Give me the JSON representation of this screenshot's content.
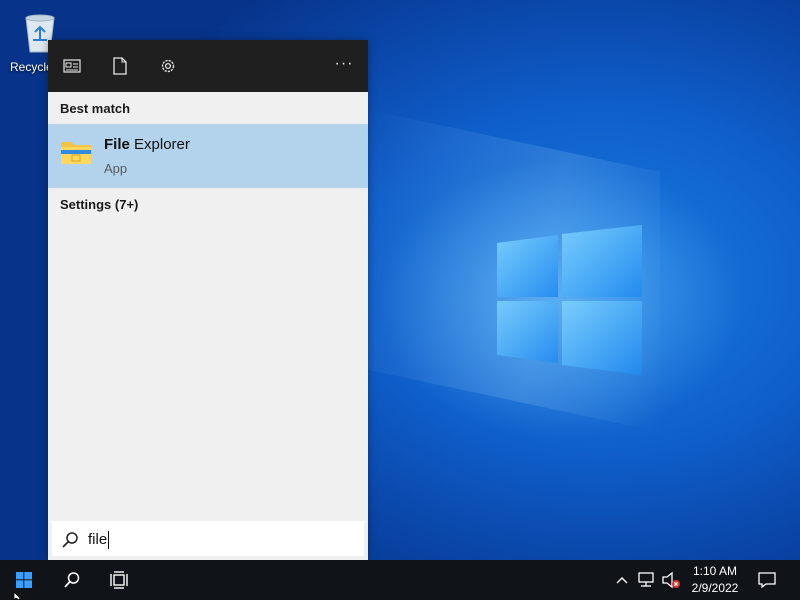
{
  "desktop": {
    "icons": [
      {
        "label": "Recycle Bin",
        "icon": "recycle-bin-icon"
      }
    ],
    "wallpaper": "windows-10-logo"
  },
  "search_panel": {
    "toolbar": {
      "buttons": [
        {
          "icon": "apps-icon"
        },
        {
          "icon": "document-icon"
        },
        {
          "icon": "gear-icon"
        }
      ],
      "more_label": "···"
    },
    "best_match_header": "Best match",
    "best_match": {
      "name_highlight": "File",
      "name_rest": " Explorer",
      "type": "App",
      "icon": "file-explorer-icon"
    },
    "settings_header": "Settings (7+)"
  },
  "search_box": {
    "query": "file",
    "icon": "search-icon"
  },
  "taskbar": {
    "start_icon": "windows-start-icon",
    "search_icon": "search-icon",
    "task_view_icon": "task-view-icon",
    "tray": {
      "icons": [
        "chevron-up-icon",
        "network-icon",
        "volume-muted-icon"
      ]
    },
    "clock": {
      "time": "1:10 AM",
      "date": "2/9/2022"
    },
    "notification_icon": "action-center-icon"
  },
  "colors": {
    "accent": "#b3d2ec",
    "taskbar": "#101418",
    "panel_dark": "#1f1f1f",
    "panel_light": "#f0f0f0"
  }
}
